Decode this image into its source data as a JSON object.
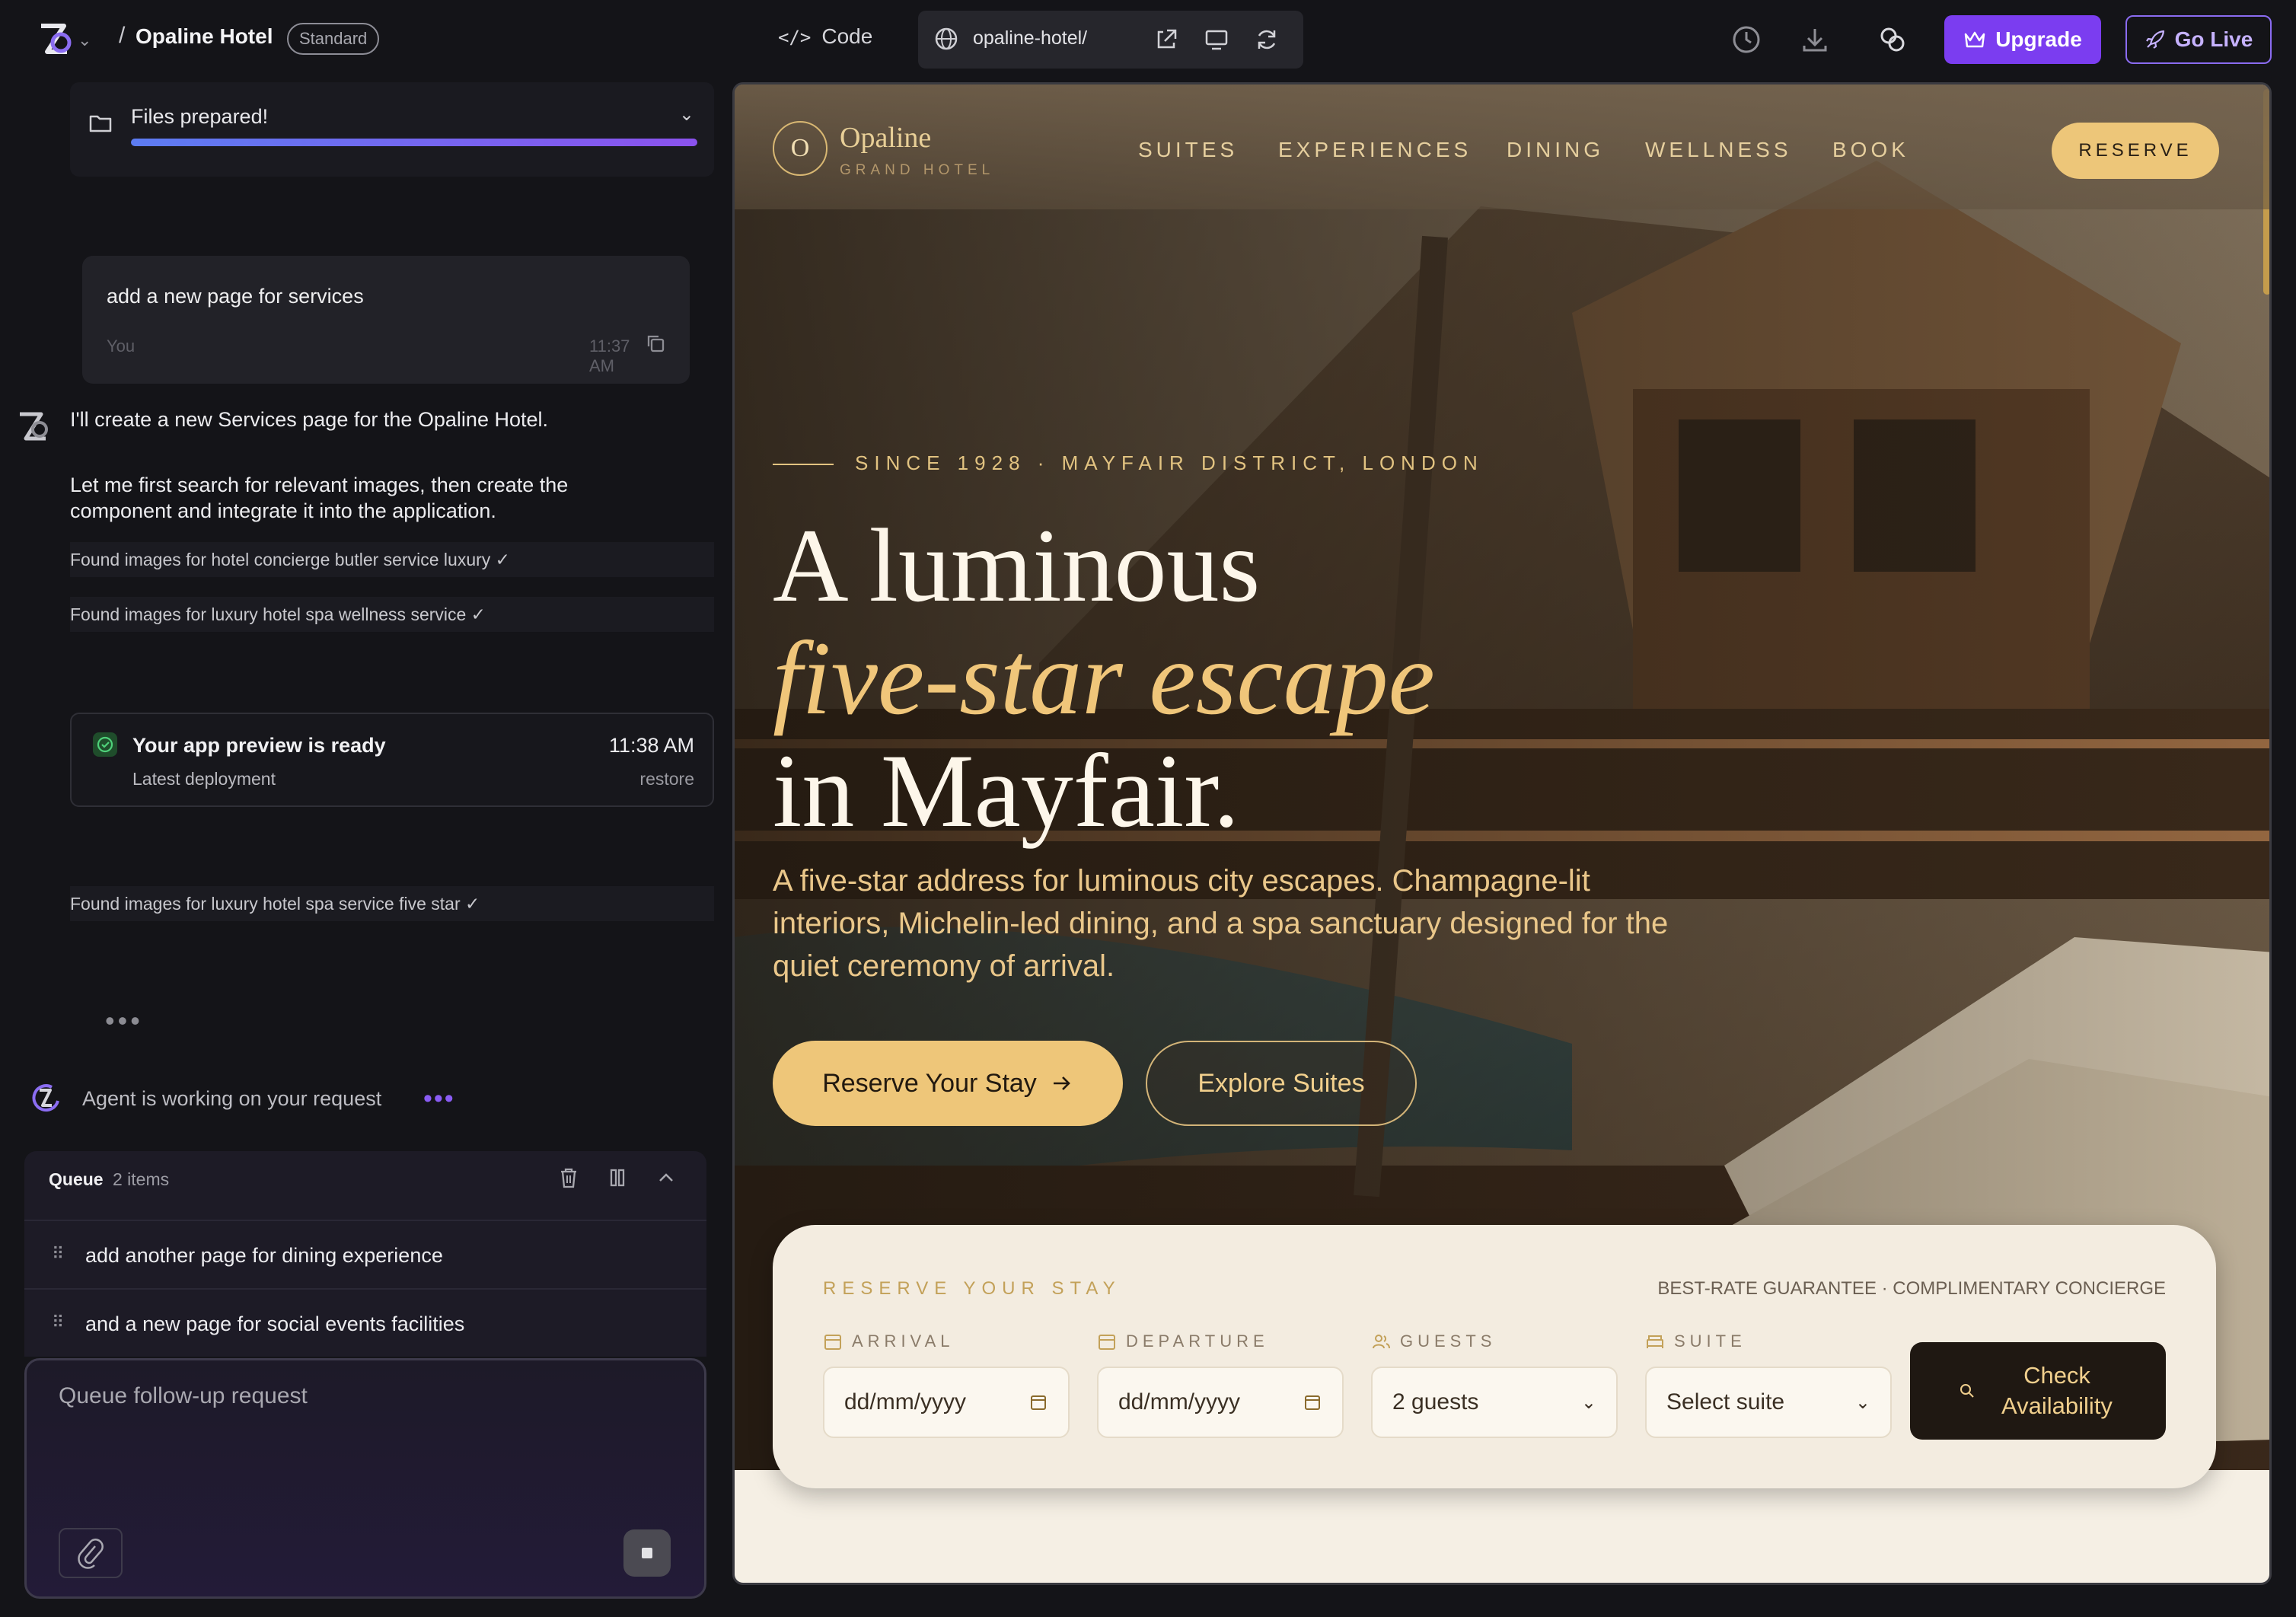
{
  "topbar": {
    "project_name": "Opaline Hotel",
    "plan_badge": "Standard",
    "code_label": "Code",
    "url": "opaline-hotel/",
    "upgrade_label": "Upgrade",
    "golive_label": "Go Live"
  },
  "chat": {
    "files_status": "Files prepared!",
    "files_progress": 1.0,
    "user_message": {
      "text": "add a new page for services",
      "author": "You",
      "time": "11:37 AM"
    },
    "agent_reply_1": "I'll create a new Services page for the Opaline Hotel.",
    "agent_reply_2": "Let me first search for relevant images, then create the component and integrate it into the application.",
    "found": [
      "Found images for hotel concierge butler service luxury ✓",
      "Found images for luxury hotel spa wellness service ✓",
      "Found images for luxury hotel spa service five star ✓"
    ],
    "preview_card": {
      "title": "Your app preview is ready",
      "subtitle": "Latest deployment",
      "time": "11:38 AM",
      "action": "restore"
    },
    "working_text": "Agent is working on your request",
    "queue": {
      "title": "Queue",
      "count": "2 items",
      "items": [
        "add another page for dining experience",
        "and a new page for social events facilities"
      ]
    },
    "input_placeholder": "Queue follow-up request"
  },
  "site": {
    "brand_name": "Opaline",
    "brand_sub": "GRAND HOTEL",
    "brand_mark": "O",
    "nav": [
      "SUITES",
      "EXPERIENCES",
      "DINING",
      "WELLNESS",
      "BOOK"
    ],
    "reserve": "RESERVE",
    "eyebrow": "SINCE 1928 · MAYFAIR DISTRICT, LONDON",
    "headline_1": "A luminous",
    "headline_2": "five-star escape",
    "headline_3": "in Mayfair.",
    "subtitle": "A five-star address for luminous city escapes. Champagne-lit interiors, Michelin-led dining, and a spa sanctuary designed for the quiet ceremony of arrival.",
    "cta_primary": "Reserve Your Stay",
    "cta_secondary": "Explore Suites",
    "booking": {
      "title": "RESERVE YOUR STAY",
      "tagline": "BEST-RATE GUARANTEE · COMPLIMENTARY CONCIERGE",
      "arrival_label": "ARRIVAL",
      "departure_label": "DEPARTURE",
      "guests_label": "GUESTS",
      "suite_label": "SUITE",
      "arrival_value": "dd/mm/yyyy",
      "departure_value": "dd/mm/yyyy",
      "guests_value": "2 guests",
      "suite_value": "Select suite",
      "check_button": "Check Availability"
    }
  },
  "colors": {
    "accent": "#7b3df0",
    "gold": "#eec679",
    "dark": "#141418"
  }
}
